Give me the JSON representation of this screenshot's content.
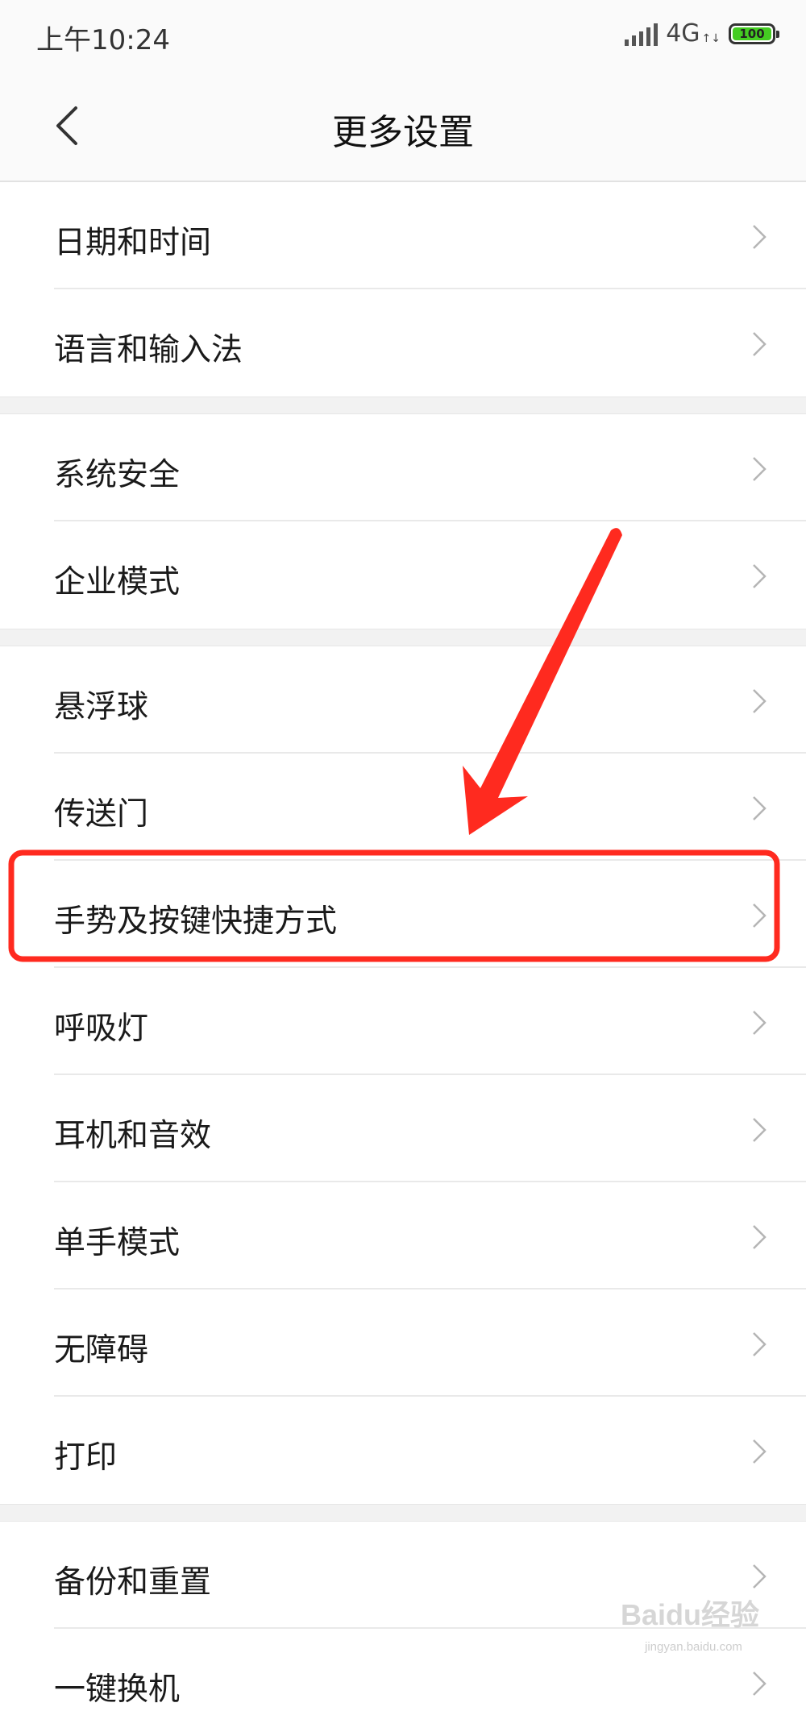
{
  "status_bar": {
    "time": "上午10:24",
    "network": "4G",
    "battery": "100"
  },
  "header": {
    "title": "更多设置",
    "back_icon": "chevron-left-icon"
  },
  "groups": [
    {
      "items": [
        {
          "label": "日期和时间"
        },
        {
          "label": "语言和输入法"
        }
      ]
    },
    {
      "items": [
        {
          "label": "系统安全"
        },
        {
          "label": "企业模式"
        }
      ]
    },
    {
      "items": [
        {
          "label": "悬浮球"
        },
        {
          "label": "传送门"
        },
        {
          "label": "手势及按键快捷方式"
        },
        {
          "label": "呼吸灯"
        },
        {
          "label": "耳机和音效"
        },
        {
          "label": "单手模式"
        },
        {
          "label": "无障碍"
        },
        {
          "label": "打印"
        }
      ]
    },
    {
      "items": [
        {
          "label": "备份和重置"
        },
        {
          "label": "一键换机"
        }
      ]
    }
  ],
  "annotation": {
    "highlighted_item": "手势及按键快捷方式",
    "color": "#ff2a1f"
  },
  "watermark": {
    "brand": "Baidu经验",
    "url": "jingyan.baidu.com"
  }
}
